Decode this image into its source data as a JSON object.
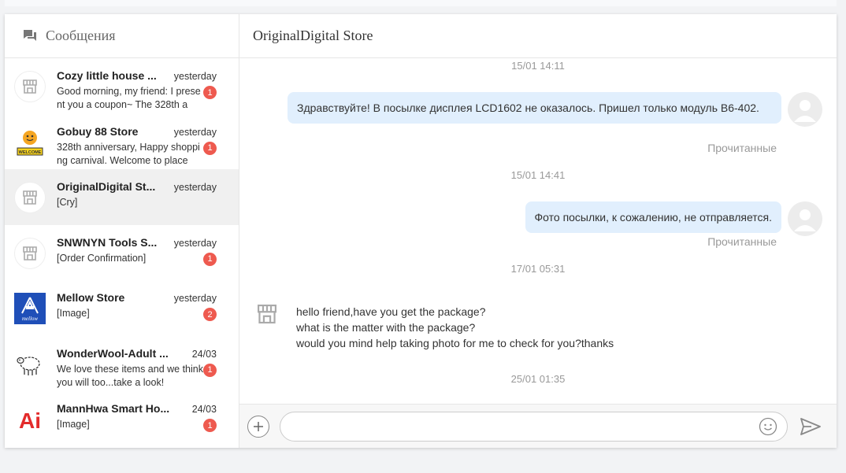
{
  "sidebar": {
    "title": "Сообщения",
    "conversations": [
      {
        "name": "Cozy little house ...",
        "time": "yesterday",
        "preview": "Good morning, my friend: I present you a coupon~ The 328th a",
        "badge": "1",
        "avatar": "store-icon"
      },
      {
        "name": "Gobuy 88 Store",
        "time": "yesterday",
        "preview": "328th anniversary, Happy shopping carnival. Welcome to place",
        "badge": "1",
        "avatar": "welcome-logo",
        "avatar_text": "WELCOME"
      },
      {
        "name": "OriginalDigital St...",
        "time": "yesterday",
        "preview": "[Cry]",
        "badge": "",
        "avatar": "store-icon"
      },
      {
        "name": "SNWNYN Tools S...",
        "time": "yesterday",
        "preview": "[Order Confirmation]",
        "badge": "1",
        "avatar": "store-icon"
      },
      {
        "name": "Mellow Store",
        "time": "yesterday",
        "preview": "[Image]",
        "badge": "2",
        "avatar": "mellow-logo",
        "avatar_text": "mellow"
      },
      {
        "name": "WonderWool-Adult ...",
        "time": "24/03",
        "preview": "We love these items and we think you will too...take a look!",
        "badge": "1",
        "avatar": "sheep-logo"
      },
      {
        "name": "MannHwa Smart Ho...",
        "time": "24/03",
        "preview": "[Image]",
        "badge": "1",
        "avatar": "ai-logo",
        "avatar_text": "Ai"
      }
    ]
  },
  "chat": {
    "title": "OriginalDigital Store",
    "ts1": "15/01 14:11",
    "msg1": "Здравствуйте! В посылке дисплея LCD1602 не оказалось. Пришел только модуль В6-402.",
    "read1": "Прочитанные",
    "ts2": "15/01 14:41",
    "msg2": "Фото посылки, к сожалению, не отправляется.",
    "read2": "Прочитанные",
    "ts3": "17/01 05:31",
    "msg3_line1": "hello friend,have you get the package?",
    "msg3_line2": "what is the matter with the package?",
    "msg3_line3": "would you mind help taking photo for me to check for you?thanks",
    "ts4": "25/01 01:35"
  },
  "composer": {
    "placeholder": ""
  },
  "colors": {
    "badge": "#ee5a4f",
    "bubble_out": "#e1effd",
    "active_row": "#f0f0f0"
  }
}
